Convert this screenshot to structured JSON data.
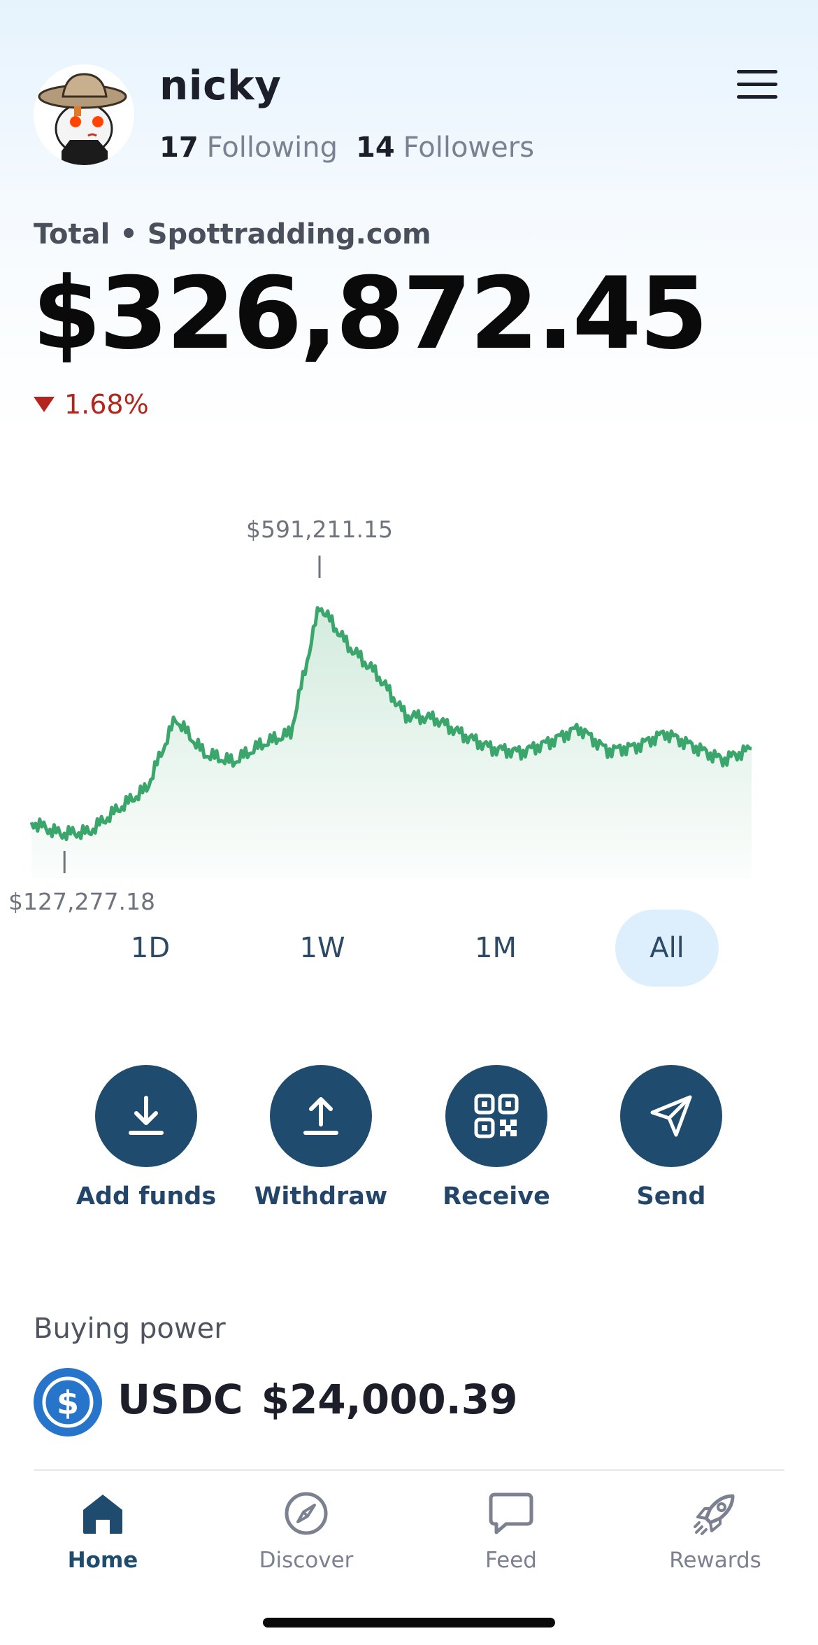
{
  "profile": {
    "username": "nicky",
    "following_count": "17",
    "following_label": "Following",
    "followers_count": "14",
    "followers_label": "Followers",
    "avatar_icon": "cowboy-avatar-icon"
  },
  "header": {
    "menu_icon": "hamburger-menu-icon"
  },
  "portfolio": {
    "total_label": "Total • Spottradding.com",
    "total_value": "$326,872.45",
    "change_direction": "down",
    "change_percent": "1.68%",
    "change_color": "#b3261e"
  },
  "chart_data": {
    "type": "area",
    "max_label": "$591,211.15",
    "min_label": "$127,277.18",
    "max_value": 591211.15,
    "min_value": 127277.18,
    "line_color": "#3aa66b",
    "x": [
      0,
      4,
      8,
      12,
      16,
      20,
      24,
      28,
      32,
      36,
      40,
      44,
      48,
      52,
      56,
      60,
      64,
      68,
      72,
      76,
      80,
      84,
      88,
      92,
      96,
      100
    ],
    "values": [
      150000,
      128000,
      131000,
      175000,
      215000,
      350000,
      282000,
      266000,
      300000,
      322000,
      568000,
      490000,
      435000,
      355000,
      350000,
      318000,
      292000,
      285000,
      305000,
      332000,
      288000,
      296000,
      322000,
      296000,
      270000,
      292000
    ]
  },
  "ranges": {
    "items": [
      "1D",
      "1W",
      "1M",
      "All"
    ],
    "selected": "All"
  },
  "actions": [
    {
      "label": "Add funds",
      "icon": "download-icon"
    },
    {
      "label": "Withdraw",
      "icon": "upload-icon"
    },
    {
      "label": "Receive",
      "icon": "qr-code-icon"
    },
    {
      "label": "Send",
      "icon": "paper-plane-icon"
    }
  ],
  "buying_power": {
    "label": "Buying power",
    "currency": "USDC",
    "amount": "$24,000.39",
    "icon": "usdc-dollar-icon",
    "icon_color": "#2775ca"
  },
  "nav": {
    "items": [
      {
        "label": "Home",
        "icon": "home-icon"
      },
      {
        "label": "Discover",
        "icon": "compass-rocket-icon"
      },
      {
        "label": "Feed",
        "icon": "chat-bubble-icon"
      },
      {
        "label": "Rewards",
        "icon": "rocket-icon"
      }
    ],
    "active": "Home"
  },
  "colors": {
    "accent_dark": "#1f4b6e",
    "range_active_bg": "#ddeffc"
  }
}
